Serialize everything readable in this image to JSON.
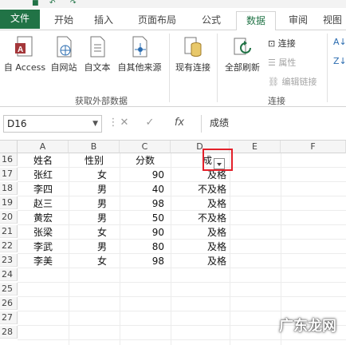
{
  "tabs": [
    "文件",
    "开始",
    "插入",
    "页面布局",
    "公式",
    "数据",
    "审阅",
    "视图"
  ],
  "ribbon": {
    "external_group_label": "获取外部数据",
    "connections_group_label": "连接",
    "buttons": {
      "access": "自 Access",
      "web": "自网站",
      "text": "自文本",
      "other": "自其他来源",
      "existing": "现有连接",
      "refresh_all": "全部刷新"
    },
    "small": {
      "connections": "连接",
      "properties": "属性",
      "edit_links": "编辑链接"
    }
  },
  "formula_bar": {
    "name_box": "D16",
    "fx": "fx",
    "value": "成绩"
  },
  "columns": [
    "A",
    "B",
    "C",
    "D",
    "E",
    "F"
  ],
  "row_numbers": [
    "16",
    "17",
    "18",
    "19",
    "20",
    "21",
    "22",
    "23",
    "24",
    "25",
    "26",
    "27",
    "28"
  ],
  "table": {
    "header": [
      "姓名",
      "性别",
      "分数",
      "成"
    ],
    "rows": [
      [
        "张红",
        "女",
        "90",
        "及格"
      ],
      [
        "李四",
        "男",
        "40",
        "不及格"
      ],
      [
        "赵三",
        "男",
        "98",
        "及格"
      ],
      [
        "黄宏",
        "男",
        "50",
        "不及格"
      ],
      [
        "张梁",
        "女",
        "90",
        "及格"
      ],
      [
        "李武",
        "男",
        "80",
        "及格"
      ],
      [
        "李美",
        "女",
        "98",
        "及格"
      ]
    ]
  },
  "watermark": "广东龙网"
}
